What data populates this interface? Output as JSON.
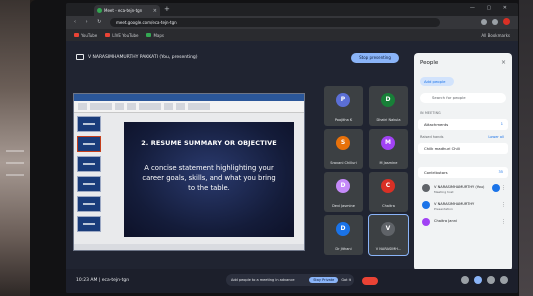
{
  "browser": {
    "tab_title": "Meet - eca-tejn-tgn",
    "tab_close": "×",
    "tab_new": "+",
    "nav_icons": "‹ › ↻",
    "address": "meet.google.com/eca-tejn-tgn",
    "bookmarks": [
      {
        "label": "YouTube",
        "color": "#ea4335"
      },
      {
        "label": "LIVE YouTube",
        "color": "#ea4335"
      },
      {
        "label": "Maps",
        "color": "#34a853"
      }
    ],
    "bookmarks_right": "All Bookmarks",
    "window_buttons": "— ▢ ✕"
  },
  "meet": {
    "presenting_label": "V NARASIMHAMURTHY PAKKATI (You, presenting)",
    "stop_presenting": "Stop presenting",
    "clock": "10:23 AM  |  eca-tejn-tgn",
    "toast_text": "Add people to a meeting in advance",
    "toast_button": "Stay Private",
    "toast_close": "Got it"
  },
  "slide": {
    "title": "2. RESUME SUMMARY OR OBJECTIVE",
    "body": "A concise statement highlighting your career goals, skills, and what you bring to the table."
  },
  "participants": [
    {
      "name": "Poojitha K",
      "initial": "P",
      "color": "#5b6fd6"
    },
    {
      "name": "Dhatri Nakula",
      "initial": "D",
      "color": "#188038"
    },
    {
      "name": "Sravani Chilluri",
      "initial": "S",
      "color": "#e8710a"
    },
    {
      "name": "M Jasmine",
      "initial": "M",
      "color": "#a142f4"
    },
    {
      "name": "Devi Jasmine",
      "initial": "D",
      "color": "#c58af9"
    },
    {
      "name": "Chaitra",
      "initial": "C",
      "color": "#d93025"
    },
    {
      "name": "Dr Jithani",
      "initial": "D",
      "color": "#1a73e8"
    },
    {
      "name": "V NARASIMH...",
      "initial": "V",
      "color": "#5f6368"
    }
  ],
  "people_panel": {
    "title": "People",
    "close": "×",
    "add_people": "Add people",
    "search_placeholder": "Search for people",
    "section_label": "IN MEETING",
    "breakout_label": "Attachments",
    "breakout_count": "1",
    "raised_label": "Raised hands",
    "raised_action": "Lower all",
    "raised_person": "Chilk madhuri Chili",
    "contributors_label": "Contributors",
    "contributors_count": "35",
    "people": [
      {
        "name": "V NARASIMHAMURTHY (You)",
        "sub": "Meeting host",
        "color": "#5f6368"
      },
      {
        "name": "V NARASIMHAMURTHY",
        "sub": "Presentation",
        "color": "#1a73e8"
      },
      {
        "name": "Chaitra Janni",
        "sub": "",
        "color": "#a142f4"
      }
    ]
  }
}
